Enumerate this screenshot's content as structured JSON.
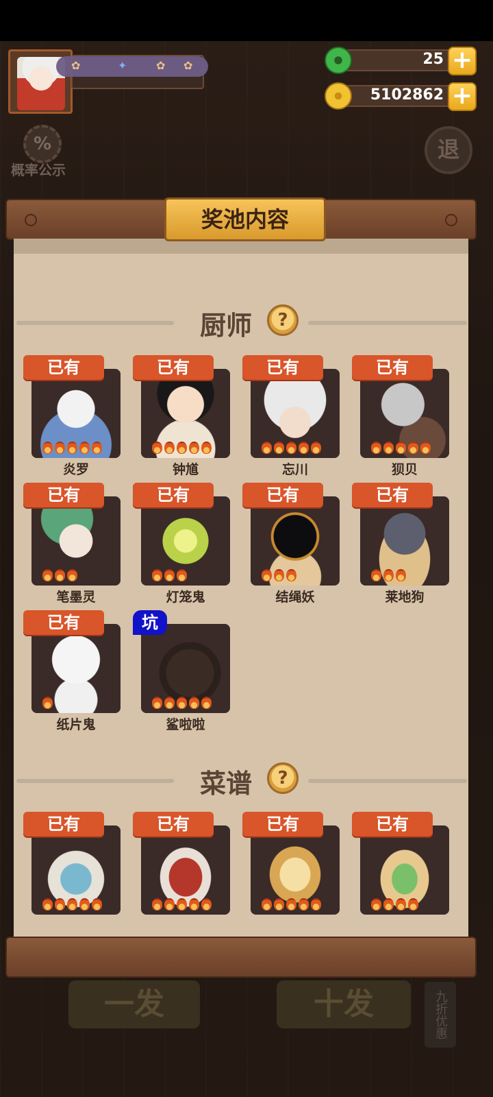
{
  "hud": {
    "currency": [
      {
        "name": "jade",
        "value": "25",
        "color": "#3fb54a"
      },
      {
        "name": "coin",
        "value": "5102862",
        "color": "#f1c232"
      }
    ],
    "probability_label": "概率公示",
    "probability_icon_text": "%",
    "exit_label": "退"
  },
  "panel": {
    "title": "奖池内容",
    "sections": [
      {
        "title": "厨师",
        "help_icon": "?"
      },
      {
        "title": "菜谱",
        "help_icon": "?"
      }
    ],
    "chefs": [
      {
        "name": "炎罗",
        "tag": "已有"
      },
      {
        "name": "钟馗",
        "tag": "已有"
      },
      {
        "name": "忘川",
        "tag": "已有"
      },
      {
        "name": "狈贝",
        "tag": "已有"
      },
      {
        "name": "笔墨灵",
        "tag": "已有"
      },
      {
        "name": "灯笼鬼",
        "tag": "已有"
      },
      {
        "name": "结绳妖",
        "tag": "已有"
      },
      {
        "name": "莱地狗",
        "tag": "已有"
      },
      {
        "name": "纸片鬼",
        "tag": "已有"
      },
      {
        "name": "鲨啦啦",
        "tag": "坑"
      }
    ],
    "recipes": [
      {
        "tag": "已有"
      },
      {
        "tag": "已有"
      },
      {
        "tag": "已有"
      },
      {
        "tag": "已有"
      }
    ]
  },
  "bottom": {
    "single_draw": "一发",
    "ten_draw": "十发",
    "discount": "九折优惠"
  },
  "colors": {
    "owned_tag": "#d9552a",
    "pit_tag": "#1212c8",
    "panel_bg": "#d6c3aa",
    "title_badge": "#f6c45a"
  }
}
